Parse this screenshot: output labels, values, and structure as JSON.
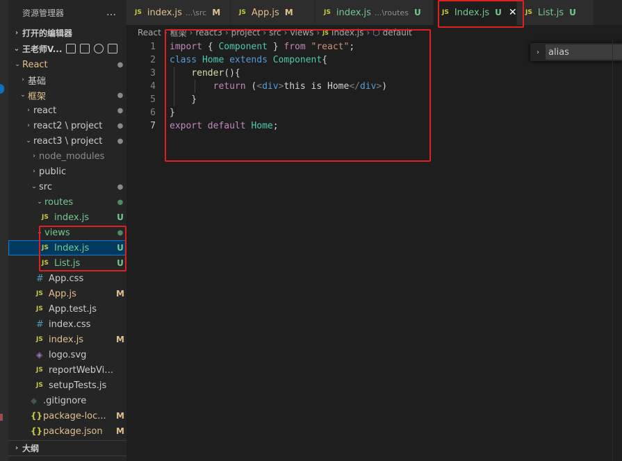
{
  "sidebar": {
    "header_title": "资源管理器",
    "more_icon": "…",
    "open_editors": "打开的编辑器",
    "workspace": "王老师V...",
    "tree": [
      {
        "label": "React",
        "indent": 0,
        "chev": "⌄",
        "badge": "●",
        "badge_class": "dot",
        "color": "yellow"
      },
      {
        "label": "基础",
        "indent": 1,
        "chev": "›",
        "badge": "",
        "badge_class": "",
        "color": ""
      },
      {
        "label": "框架",
        "indent": 1,
        "chev": "⌄",
        "badge": "●",
        "badge_class": "dot",
        "color": "yellow"
      },
      {
        "label": "react",
        "indent": 2,
        "chev": "›",
        "badge": "●",
        "badge_class": "dot",
        "color": ""
      },
      {
        "label": "react2 \\ project",
        "indent": 2,
        "chev": "›",
        "badge": "●",
        "badge_class": "dot",
        "color": ""
      },
      {
        "label": "react3 \\ project",
        "indent": 2,
        "chev": "⌄",
        "badge": "●",
        "badge_class": "dot",
        "color": ""
      },
      {
        "label": "node_modules",
        "indent": 3,
        "chev": "›",
        "badge": "",
        "badge_class": "",
        "color": "dim"
      },
      {
        "label": "public",
        "indent": 3,
        "chev": "›",
        "badge": "",
        "badge_class": "",
        "color": ""
      },
      {
        "label": "src",
        "indent": 3,
        "chev": "⌄",
        "badge": "●",
        "badge_class": "dot",
        "color": ""
      },
      {
        "label": "routes",
        "indent": 4,
        "chev": "⌄",
        "badge": "●",
        "badge_class": "dotg",
        "color": "green"
      },
      {
        "label": "index.js",
        "indent": 5,
        "chev": "",
        "icon": "JS",
        "badge": "U",
        "badge_class": "u",
        "color": "green"
      },
      {
        "label": "views",
        "indent": 4,
        "chev": "⌄",
        "badge": "●",
        "badge_class": "dotg",
        "color": "green"
      },
      {
        "label": "Index.js",
        "indent": 5,
        "chev": "",
        "icon": "JS",
        "badge": "U",
        "badge_class": "u",
        "color": "green",
        "selected": true
      },
      {
        "label": "List.js",
        "indent": 5,
        "chev": "",
        "icon": "JS",
        "badge": "U",
        "badge_class": "u",
        "color": "green"
      },
      {
        "label": "App.css",
        "indent": 4,
        "chev": "",
        "icon": "#",
        "icon_class": "css",
        "badge": "",
        "badge_class": "",
        "color": ""
      },
      {
        "label": "App.js",
        "indent": 4,
        "chev": "",
        "icon": "JS",
        "badge": "M",
        "badge_class": "m",
        "color": "yellow"
      },
      {
        "label": "App.test.js",
        "indent": 4,
        "chev": "",
        "icon": "JS",
        "badge": "",
        "badge_class": "",
        "color": ""
      },
      {
        "label": "index.css",
        "indent": 4,
        "chev": "",
        "icon": "#",
        "icon_class": "css",
        "badge": "",
        "badge_class": "",
        "color": ""
      },
      {
        "label": "index.js",
        "indent": 4,
        "chev": "",
        "icon": "JS",
        "badge": "M",
        "badge_class": "m",
        "color": "yellow"
      },
      {
        "label": "logo.svg",
        "indent": 4,
        "chev": "",
        "icon": "◈",
        "icon_class": "svg",
        "badge": "",
        "badge_class": "",
        "color": ""
      },
      {
        "label": "reportWebVitals.js",
        "indent": 4,
        "chev": "",
        "icon": "JS",
        "badge": "",
        "badge_class": "",
        "color": ""
      },
      {
        "label": "setupTests.js",
        "indent": 4,
        "chev": "",
        "icon": "JS",
        "badge": "",
        "badge_class": "",
        "color": ""
      },
      {
        "label": ".gitignore",
        "indent": 3,
        "chev": "",
        "icon": "◆",
        "icon_class": "git",
        "badge": "",
        "badge_class": "",
        "color": ""
      },
      {
        "label": "package-loc...",
        "indent": 3,
        "chev": "",
        "icon": "{}",
        "icon_class": "json",
        "badge": "M",
        "badge_class": "m",
        "color": "yellow"
      },
      {
        "label": "package.json",
        "indent": 3,
        "chev": "",
        "icon": "{}",
        "icon_class": "json",
        "badge": "M",
        "badge_class": "m",
        "color": "yellow"
      }
    ],
    "outline": "大纲"
  },
  "tabs": [
    {
      "label": "index.js",
      "desc": "...\\src",
      "status": "M",
      "status_class": "yellow",
      "color": "yellow",
      "active": false
    },
    {
      "label": "App.js",
      "desc": "",
      "status": "M",
      "status_class": "yellow",
      "color": "yellow",
      "active": false
    },
    {
      "label": "index.js",
      "desc": "...\\routes",
      "status": "U",
      "status_class": "green",
      "color": "green",
      "active": false
    },
    {
      "label": "Index.js",
      "desc": "",
      "status": "U",
      "status_class": "green",
      "color": "green",
      "active": true,
      "close": "✕"
    },
    {
      "label": "List.js",
      "desc": "",
      "status": "U",
      "status_class": "green",
      "color": "green",
      "active": false
    }
  ],
  "breadcrumb": {
    "items": [
      "React",
      "框架",
      "react3",
      "project",
      "src",
      "views",
      "Index.js",
      "default"
    ]
  },
  "editor": {
    "lines": [
      {
        "n": "1",
        "html": [
          [
            "kw",
            "import"
          ],
          [
            "",
            " { "
          ],
          [
            "cls",
            "Component"
          ],
          [
            "",
            " } "
          ],
          [
            "kw",
            "from"
          ],
          [
            "",
            " "
          ],
          [
            "str",
            "\"react\""
          ],
          [
            "",
            ";"
          ]
        ]
      },
      {
        "n": "2",
        "html": [
          [
            "kw2",
            "class"
          ],
          [
            "",
            " "
          ],
          [
            "cls",
            "Home"
          ],
          [
            "",
            " "
          ],
          [
            "kw2",
            "extends"
          ],
          [
            "",
            " "
          ],
          [
            "cls",
            "Component"
          ],
          [
            "",
            "{"
          ]
        ]
      },
      {
        "n": "3",
        "html": [
          [
            "",
            "    "
          ],
          [
            "fn",
            "render"
          ],
          [
            "",
            "(){"
          ]
        ]
      },
      {
        "n": "4",
        "html": [
          [
            "",
            "        "
          ],
          [
            "kw",
            "return"
          ],
          [
            "",
            " ("
          ],
          [
            "tagc",
            "<"
          ],
          [
            "tag",
            "div"
          ],
          [
            "tagc",
            ">"
          ],
          [
            "",
            "this is Home"
          ],
          [
            "tagc",
            "</"
          ],
          [
            "tag",
            "div"
          ],
          [
            "tagc",
            ">"
          ],
          [
            "",
            ")"
          ]
        ]
      },
      {
        "n": "5",
        "html": [
          [
            "",
            "    }"
          ]
        ]
      },
      {
        "n": "6",
        "html": [
          [
            "",
            "}"
          ]
        ]
      },
      {
        "n": "7",
        "html": [
          [
            "kw",
            "export"
          ],
          [
            "",
            " "
          ],
          [
            "kw",
            "default"
          ],
          [
            "",
            " "
          ],
          [
            "cls",
            "Home"
          ],
          [
            "",
            ";"
          ]
        ]
      }
    ],
    "current_line": "7"
  },
  "search": {
    "value": "alias"
  }
}
